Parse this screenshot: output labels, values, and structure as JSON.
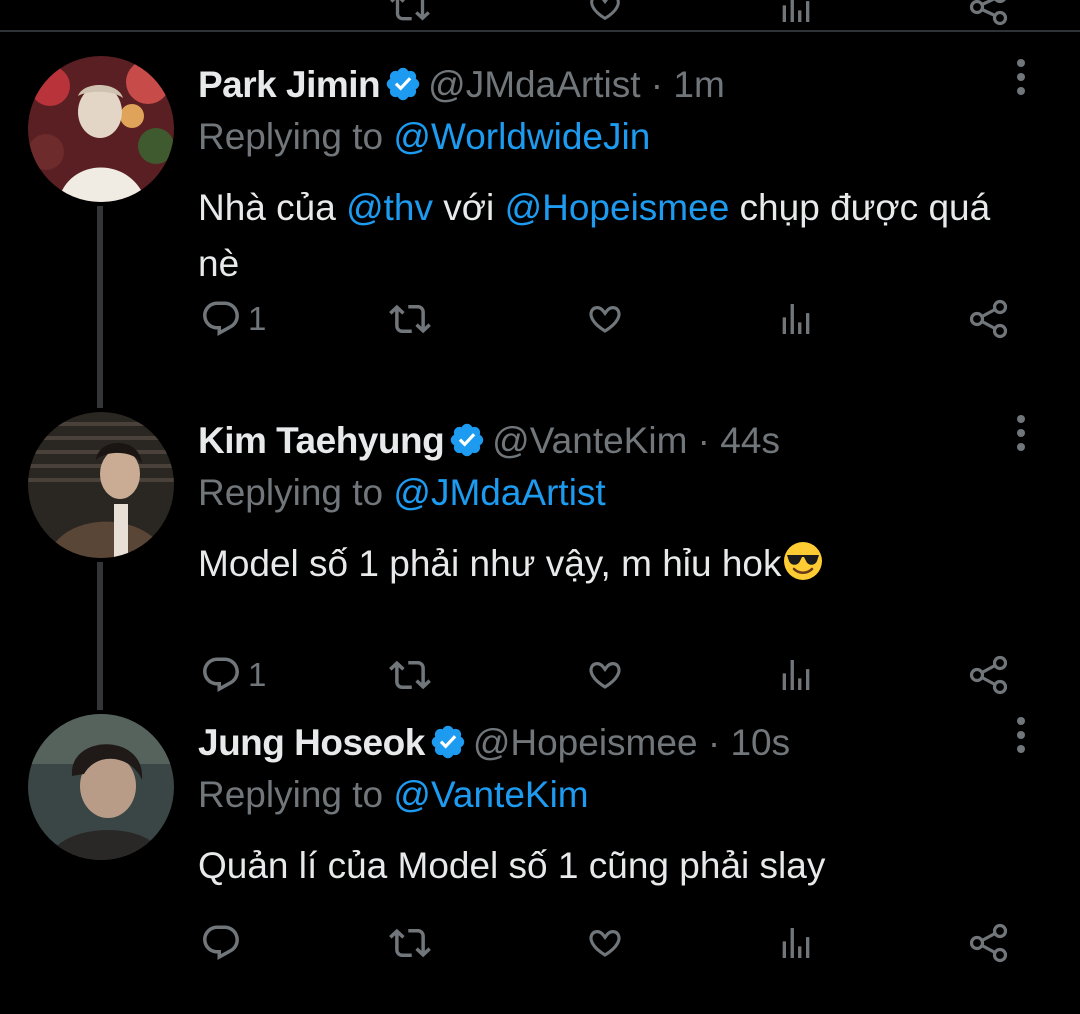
{
  "tweets": [
    {
      "name": "Park Jimin",
      "handle": "@JMdaArtist",
      "sep": " · ",
      "time": "1m",
      "replying_prefix": "Replying to ",
      "replying_to": "@WorldwideJin",
      "text_parts": [
        "Nhà của ",
        "@thv",
        " với ",
        "@Hopeismee",
        " chụp được quá nè"
      ],
      "reply_count": "1",
      "avatar_colors": [
        "#8a2b2b",
        "#d9d2c6",
        "#3f5a2f"
      ]
    },
    {
      "name": "Kim Taehyung",
      "handle": "@VanteKim",
      "sep": " · ",
      "time": "44s",
      "replying_prefix": "Replying to ",
      "replying_to": "@JMdaArtist",
      "text": "Model số 1 phải như vậy, m hỉu hok",
      "emoji": "smiling-face-with-sunglasses",
      "reply_count": "1",
      "avatar_colors": [
        "#2a2622",
        "#7b6b5a",
        "#c9bba8"
      ]
    },
    {
      "name": "Jung Hoseok",
      "handle": "@Hopeismee",
      "sep": " · ",
      "time": "10s",
      "replying_prefix": "Replying to ",
      "replying_to": "@VanteKim",
      "text": "Quản lí của Model số 1 cũng phải slay",
      "reply_count": "",
      "avatar_colors": [
        "#2c3a3a",
        "#5d6a63",
        "#9aa39a"
      ]
    }
  ],
  "icons": {
    "reply": "reply-icon",
    "retweet": "retweet-icon",
    "like": "heart-icon",
    "views": "views-icon",
    "share": "share-icon",
    "more": "more-vertical-icon",
    "verified": "verified-badge-icon"
  },
  "colors": {
    "background": "#000000",
    "text": "#e7e9ea",
    "muted": "#71767b",
    "accent": "#1d9bf0",
    "divider": "#2f3336"
  }
}
